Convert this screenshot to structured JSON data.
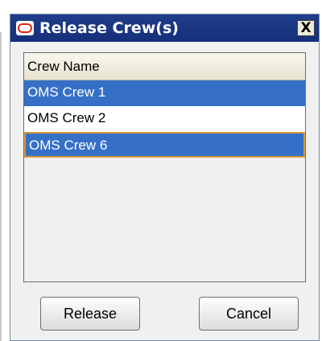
{
  "dialog": {
    "title": "Release Crew(s)",
    "close_label": "X"
  },
  "crew_list": {
    "column_header": "Crew Name",
    "rows": [
      {
        "name": "OMS Crew 1",
        "selected": true,
        "focused": false
      },
      {
        "name": "OMS Crew 2",
        "selected": false,
        "focused": false
      },
      {
        "name": "OMS Crew 6",
        "selected": true,
        "focused": true
      }
    ]
  },
  "buttons": {
    "release_label": "Release",
    "cancel_label": "Cancel"
  },
  "colors": {
    "titlebar": "#1f3d8a",
    "selection": "#3670c6",
    "focus_border": "#d99a3a",
    "logo_red": "#e0231a"
  },
  "icons": {
    "title_logo": "oracle-logo-icon",
    "close": "close-icon"
  }
}
